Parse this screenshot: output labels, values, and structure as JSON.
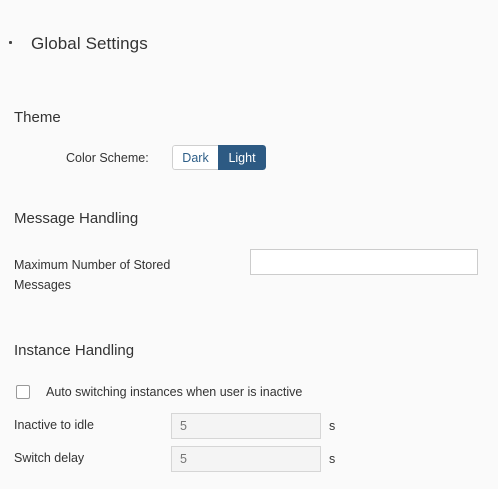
{
  "header": {
    "title": "Global Settings"
  },
  "theme": {
    "section_title": "Theme",
    "color_scheme_label": "Color Scheme:",
    "options": [
      "Dark",
      "Light"
    ],
    "selected": "Light"
  },
  "message_handling": {
    "section_title": "Message Handling",
    "max_stored_label": "Maximum Number of Stored Messages",
    "max_stored_value": ""
  },
  "instance_handling": {
    "section_title": "Instance Handling",
    "auto_switch_label": "Auto switching instances when user is inactive",
    "auto_switch_checked": false,
    "inactive_label": "Inactive to idle",
    "inactive_placeholder": "5",
    "inactive_unit": "s",
    "switch_delay_label": "Switch delay",
    "switch_delay_placeholder": "5",
    "switch_delay_unit": "s"
  },
  "colors": {
    "accent": "#2d5a83",
    "panel_bg": "#fafafa"
  }
}
